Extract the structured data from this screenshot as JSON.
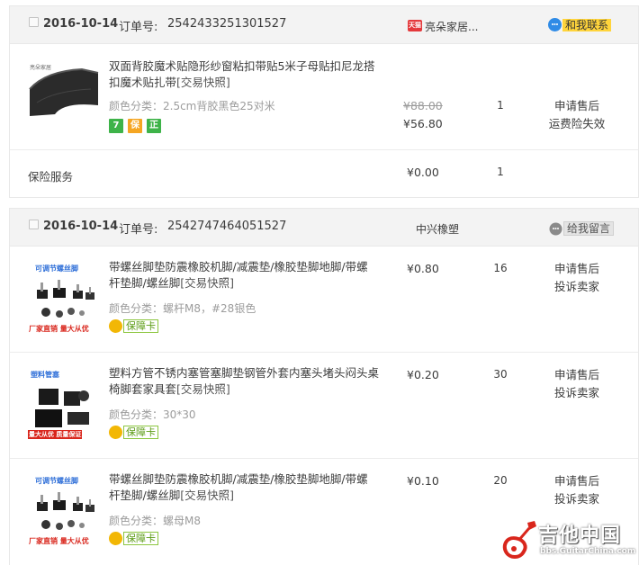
{
  "orders": [
    {
      "date": "2016-10-14",
      "order_no_label": "订单号:",
      "order_no": "2542433251301527",
      "shop_icon_text": "天猫",
      "shop": "亮朵家居...",
      "contact_label": "和我联系",
      "items": [
        {
          "title": "双面背胶魔术贴隐形纱窗粘扣带贴5米子母贴扣尼龙搭扣魔术贴扎带",
          "snapshot": "[交易快照]",
          "spec": "颜色分类：2.5cm背胶黑色25对米",
          "price_old": "¥88.00",
          "price": "¥56.80",
          "qty": "1",
          "actions": [
            "申请售后",
            "运费险失效"
          ],
          "badges": [
            "7",
            "保",
            "正"
          ],
          "thumb_brand": "亮朵家居"
        },
        {
          "title": "保险服务",
          "price": "¥0.00",
          "qty": "1"
        }
      ]
    },
    {
      "date": "2016-10-14",
      "order_no_label": "订单号:",
      "order_no": "2542747464051527",
      "shop": "中兴橡塑",
      "contact_label": "给我留言",
      "items": [
        {
          "title": "带螺丝脚垫防震橡胶机脚/减震垫/橡胶垫脚地脚/带螺杆垫脚/螺丝脚",
          "snapshot": "[交易快照]",
          "spec": "颜色分类：螺杆M8，#28银色",
          "price": "¥0.80",
          "qty": "16",
          "actions": [
            "申请售后",
            "投诉卖家"
          ],
          "guarantee": "保障卡",
          "thumb_top": "可调节螺丝脚",
          "thumb_bottom": "厂家直销 量大从优"
        },
        {
          "title": "塑料方管不锈内塞管塞脚垫钢管外套内塞头堵头闷头桌椅脚套家具套",
          "snapshot": "[交易快照]",
          "spec": "颜色分类：30*30",
          "price": "¥0.20",
          "qty": "30",
          "actions": [
            "申请售后",
            "投诉卖家"
          ],
          "guarantee": "保障卡",
          "thumb_top": "塑料管塞",
          "thumb_bottom": "量大从优 质量保证"
        },
        {
          "title": "带螺丝脚垫防震橡胶机脚/减震垫/橡胶垫脚地脚/带螺杆垫脚/螺丝脚",
          "snapshot": "[交易快照]",
          "spec": "颜色分类：螺母M8",
          "price": "¥0.10",
          "qty": "20",
          "actions": [
            "申请售后",
            "投诉卖家"
          ],
          "guarantee": "保障卡",
          "thumb_top": "可调节螺丝脚",
          "thumb_bottom": "厂家直销 量大从优"
        }
      ]
    }
  ],
  "watermark": {
    "title": "吉他中国",
    "url": "bbs.GuitarChina.com"
  },
  "colors": {
    "header_bg": "#f3f3f3",
    "contact_yellow": "#ffd43b",
    "badge_green": "#3eb349",
    "badge_yellow": "#f5a623",
    "watermark_red": "#d9261c"
  }
}
